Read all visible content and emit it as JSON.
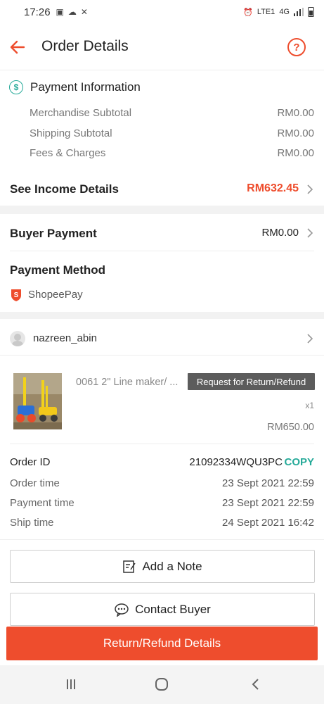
{
  "status_bar": {
    "time": "17:26",
    "network": "4G",
    "network_sub": "LTE1"
  },
  "header": {
    "title": "Order Details"
  },
  "payment_info": {
    "title": "Payment Information",
    "rows": [
      {
        "label": "Merchandise Subtotal",
        "value": "RM0.00"
      },
      {
        "label": "Shipping Subtotal",
        "value": "RM0.00"
      },
      {
        "label": "Fees & Charges",
        "value": "RM0.00"
      }
    ],
    "income_label": "See Income Details",
    "income_value": "RM632.45"
  },
  "buyer_payment": {
    "label": "Buyer Payment",
    "value": "RM0.00"
  },
  "payment_method": {
    "label": "Payment Method",
    "method": "ShopeePay"
  },
  "buyer": {
    "username": "nazreen_abin"
  },
  "product": {
    "name": "0061 2\" Line maker/ ...",
    "tag": "Request for Return/Refund",
    "quantity": "x1",
    "price": "RM650.00"
  },
  "order": {
    "id_label": "Order ID",
    "id_value": "21092334WQU3PC",
    "copy_label": "COPY",
    "rows": [
      {
        "label": "Order time",
        "value": "23 Sept 2021 22:59"
      },
      {
        "label": "Payment time",
        "value": "23 Sept 2021 22:59"
      },
      {
        "label": "Ship time",
        "value": "24 Sept 2021 16:42"
      }
    ]
  },
  "actions": {
    "add_note": "Add a Note",
    "contact_buyer": "Contact Buyer",
    "return_refund": "Return/Refund Details"
  },
  "colors": {
    "brand": "#ee4d2d",
    "accent": "#26aa99"
  }
}
